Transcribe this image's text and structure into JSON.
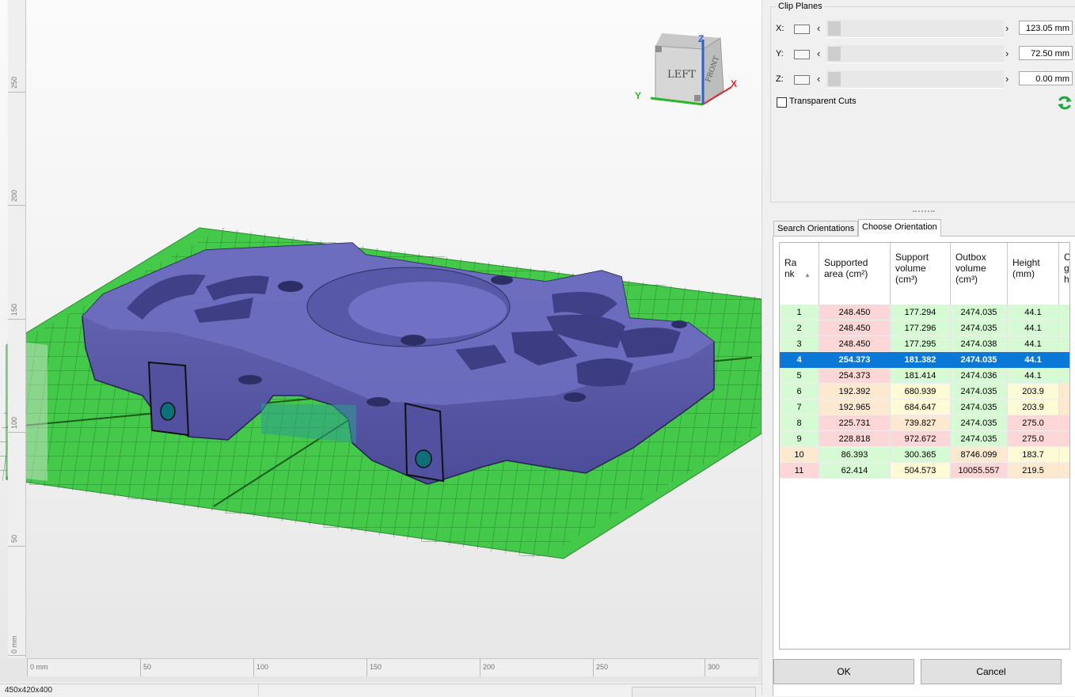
{
  "viewport": {
    "ruler_vertical_labels": [
      "0 mm",
      "50",
      "100",
      "150",
      "200",
      "250"
    ],
    "ruler_horizontal_labels": [
      "0 mm",
      "50",
      "100",
      "150",
      "200",
      "250",
      "300"
    ],
    "view_cube": {
      "left_label": "LEFT",
      "front_label": "FRONT",
      "axis_x": "X",
      "axis_y": "Y",
      "axis_z": "Z"
    },
    "colors": {
      "model": "#5656a6",
      "build_plate": "#44c94a",
      "grid_lines": "#1f6f22",
      "axis_x": "#e0282b",
      "axis_y": "#2db52d",
      "axis_z": "#2a62c9"
    }
  },
  "statusbar": {
    "dimensions": "450x420x400"
  },
  "clip_planes": {
    "title": "Clip Planes",
    "rows": [
      {
        "axis": "X:",
        "value": "123.05 mm"
      },
      {
        "axis": "Y:",
        "value": "72.50 mm"
      },
      {
        "axis": "Z:",
        "value": "0.00 mm"
      }
    ],
    "transparent_cuts_label": "Transparent Cuts",
    "transparent_cuts_checked": false
  },
  "tabs": [
    {
      "label": "Search Orientations",
      "active": false
    },
    {
      "label": "Choose Orientation",
      "active": true
    }
  ],
  "table": {
    "headers": [
      "Ra\nnk",
      "Supported\narea (cm²)",
      "Support\nvolume\n(cm³)",
      "Outbox\nvolume\n(cm³)",
      "Height\n(mm)",
      "C\ng\nh"
    ],
    "selected_rank": "4",
    "rows": [
      {
        "cells": [
          "1",
          "248.450",
          "177.294",
          "2474.035",
          "44.1"
        ],
        "colors": [
          "green",
          "red",
          "green",
          "green",
          "green",
          "green"
        ]
      },
      {
        "cells": [
          "2",
          "248.450",
          "177.296",
          "2474.035",
          "44.1"
        ],
        "colors": [
          "green",
          "red",
          "green",
          "green",
          "green",
          "green"
        ]
      },
      {
        "cells": [
          "3",
          "248.450",
          "177.295",
          "2474.038",
          "44.1"
        ],
        "colors": [
          "green",
          "red",
          "green",
          "green",
          "green",
          "green"
        ]
      },
      {
        "cells": [
          "4",
          "254.373",
          "181.382",
          "2474.035",
          "44.1"
        ],
        "colors": [
          "green",
          "red",
          "green",
          "green",
          "green",
          "green"
        ]
      },
      {
        "cells": [
          "5",
          "254.373",
          "181.414",
          "2474.036",
          "44.1"
        ],
        "colors": [
          "green",
          "red",
          "green",
          "green",
          "green",
          "green"
        ]
      },
      {
        "cells": [
          "6",
          "192.392",
          "680.939",
          "2474.035",
          "203.9"
        ],
        "colors": [
          "green",
          "orange",
          "yellow",
          "green",
          "yellow",
          "orange"
        ]
      },
      {
        "cells": [
          "7",
          "192.965",
          "684.647",
          "2474.035",
          "203.9"
        ],
        "colors": [
          "green",
          "orange",
          "yellow",
          "green",
          "yellow",
          "orange"
        ]
      },
      {
        "cells": [
          "8",
          "225.731",
          "739.827",
          "2474.035",
          "275.0"
        ],
        "colors": [
          "green",
          "red",
          "orange",
          "green",
          "red",
          "red"
        ]
      },
      {
        "cells": [
          "9",
          "228.818",
          "972.672",
          "2474.035",
          "275.0"
        ],
        "colors": [
          "green",
          "red",
          "red",
          "green",
          "red",
          "red"
        ]
      },
      {
        "cells": [
          "10",
          "86.393",
          "300.365",
          "8746.099",
          "183.7"
        ],
        "colors": [
          "orange",
          "green",
          "green",
          "orange",
          "yellow",
          "yellow"
        ]
      },
      {
        "cells": [
          "11",
          "62.414",
          "504.573",
          "10055.557",
          "219.5"
        ],
        "colors": [
          "red",
          "green",
          "yellow",
          "red",
          "orange",
          "orange"
        ]
      }
    ]
  },
  "buttons": {
    "ok": "OK",
    "cancel": "Cancel"
  }
}
